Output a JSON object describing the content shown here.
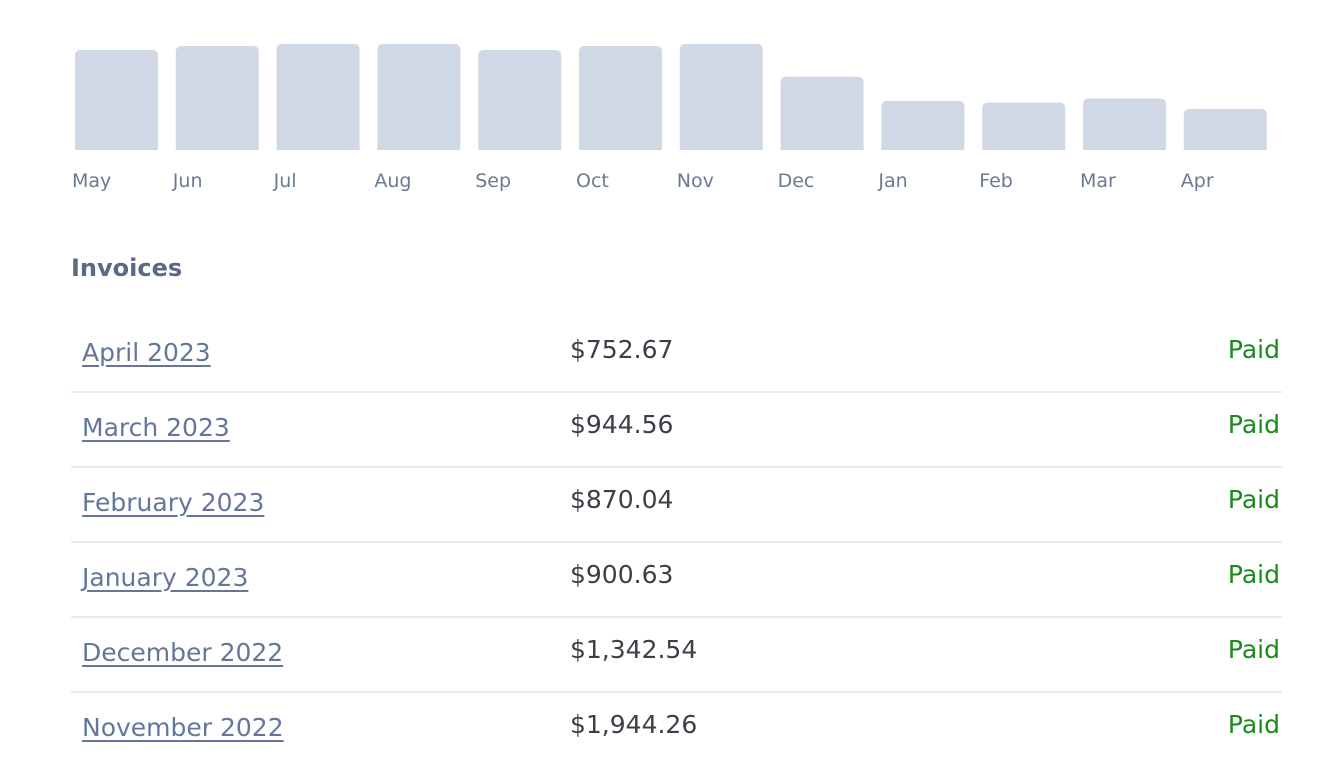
{
  "colors": {
    "bar": "#d0d7e5",
    "tick": "#6b7a93",
    "link": "#64779a",
    "paid": "#1a8a1a"
  },
  "chart_data": {
    "type": "bar",
    "title": "",
    "xlabel": "",
    "ylabel": "",
    "categories": [
      "May",
      "Jun",
      "Jul",
      "Aug",
      "Sep",
      "Oct",
      "Nov",
      "Dec",
      "Jan",
      "Feb",
      "Mar",
      "Apr"
    ],
    "values": [
      1834,
      1908,
      1944.26,
      1944,
      1834,
      1908,
      1944.26,
      1342.54,
      900.63,
      870.04,
      944.56,
      752.67
    ],
    "ylim": [
      0,
      1944.26
    ],
    "grid": false,
    "legend": "none"
  },
  "invoices": {
    "title": "Invoices",
    "rows": [
      {
        "period": "April 2023",
        "amount": "$752.67",
        "status": "Paid"
      },
      {
        "period": "March 2023",
        "amount": "$944.56",
        "status": "Paid"
      },
      {
        "period": "February 2023",
        "amount": "$870.04",
        "status": "Paid"
      },
      {
        "period": "January 2023",
        "amount": "$900.63",
        "status": "Paid"
      },
      {
        "period": "December 2022",
        "amount": "$1,342.54",
        "status": "Paid"
      },
      {
        "period": "November 2022",
        "amount": "$1,944.26",
        "status": "Paid"
      }
    ]
  }
}
